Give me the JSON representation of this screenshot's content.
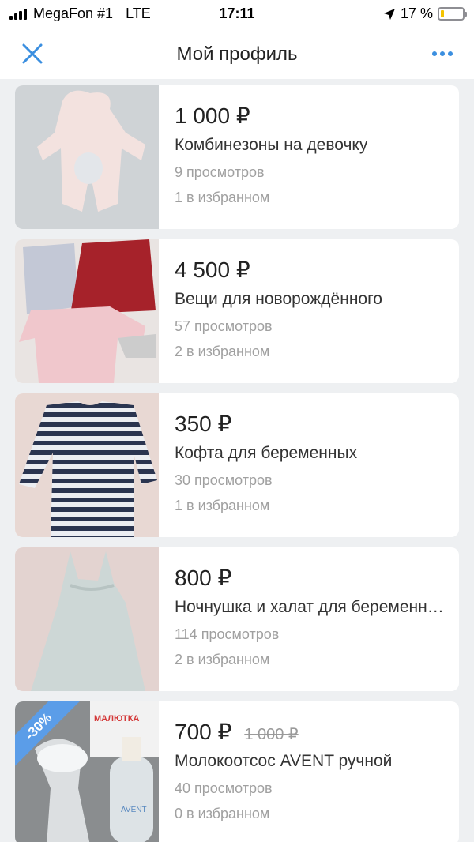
{
  "status_bar": {
    "carrier": "MegaFon #1",
    "network": "LTE",
    "time": "17:11",
    "battery": "17 %",
    "battery_level": 0.17,
    "battery_color": "#f5c400"
  },
  "nav": {
    "title": "Мой профиль",
    "close_icon": "close-icon",
    "more_icon": "more-dots-icon",
    "accent_color": "#3b8fe0"
  },
  "listings": [
    {
      "price": "1 000 ₽",
      "old_price": "",
      "title": "Комбинезоны на девочку",
      "views": "9 просмотров",
      "favorites": "1 в избранном",
      "discount": ""
    },
    {
      "price": "4 500 ₽",
      "old_price": "",
      "title": "Вещи для новорождённого",
      "views": "57 просмотров",
      "favorites": "2 в избранном",
      "discount": ""
    },
    {
      "price": "350 ₽",
      "old_price": "",
      "title": "Кофта для беременных",
      "views": "30 просмотров",
      "favorites": "1 в избранном",
      "discount": ""
    },
    {
      "price": "800 ₽",
      "old_price": "",
      "title": "Ночнушка и халат для беременных",
      "views": "114 просмотров",
      "favorites": "2 в избранном",
      "discount": ""
    },
    {
      "price": "700 ₽",
      "old_price": "1 000 ₽",
      "title": "Молокоотсос AVENT ручной",
      "views": "40 просмотров",
      "favorites": "0 в избранном",
      "discount": "-30%",
      "photo_text": [
        "МАЛЮТКА",
        "AVENT"
      ]
    }
  ]
}
